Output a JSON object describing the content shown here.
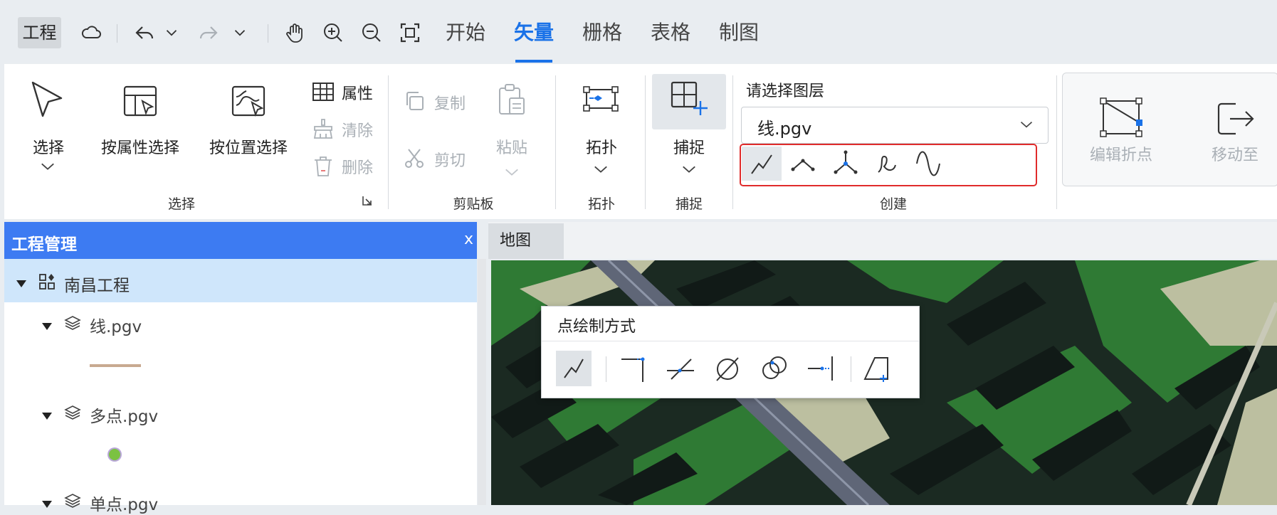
{
  "topbar": {
    "project_menu": "工程",
    "tabs": [
      "开始",
      "矢量",
      "栅格",
      "表格",
      "制图"
    ],
    "active_tab": "矢量"
  },
  "ribbon": {
    "select": "选择",
    "select_by_attr": "按属性选择",
    "select_by_loc": "按位置选择",
    "attributes": "属性",
    "clear": "清除",
    "delete": "删除",
    "group_select": "选择",
    "copy": "复制",
    "cut": "剪切",
    "paste": "粘贴",
    "group_clipboard": "剪贴板",
    "topology": "拓扑",
    "group_topology": "拓扑",
    "snap": "捕捉",
    "group_snap": "捕捉",
    "layer_prompt": "请选择图层",
    "layer_value": "线.pgv",
    "group_create": "创建",
    "edit_vertex": "编辑折点",
    "move_to": "移动至"
  },
  "project_panel": {
    "title": "工程管理",
    "close": "x",
    "root": "南昌工程",
    "layers": [
      "线.pgv",
      "多点.pgv",
      "单点.pgv"
    ]
  },
  "map": {
    "tab": "地图",
    "popup_title": "点绘制方式"
  },
  "colors": {
    "accent": "#1a72e8",
    "panel_header": "#3d7bf2",
    "highlight_border": "#e02b2b",
    "line_symbol": "#c8aa90",
    "point_symbol": "#7bc242"
  }
}
